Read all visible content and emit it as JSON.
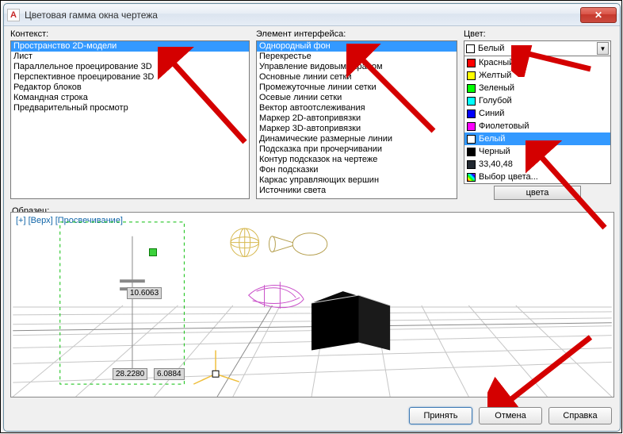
{
  "window": {
    "title": "Цветовая гамма окна чертежа",
    "icon_letter": "A"
  },
  "context": {
    "label": "Контекст:",
    "items": [
      "Пространство 2D-модели",
      "Лист",
      "Параллельное проецирование 3D",
      "Перспективное проецирование 3D",
      "Редактор блоков",
      "Командная строка",
      "Предварительный просмотр"
    ],
    "selected_index": 0
  },
  "elements": {
    "label": "Элемент интерфейса:",
    "items": [
      "Однородный фон",
      "Перекрестье",
      "Управление видовым экраном",
      "Основные линии сетки",
      "Промежуточные линии сетки",
      "Осевые линии сетки",
      "Вектор автоотслеживания",
      "Маркер 2D-автопривязки",
      "Маркер 3D-автопривязки",
      "Динамические размерные линии",
      "Подсказка при прочерчивании",
      "Контур подсказок на чертеже",
      "Фон подсказки",
      "Каркас управляющих вершин",
      "Источники света"
    ],
    "selected_index": 0
  },
  "color": {
    "label": "Цвет:",
    "selected_label": "Белый",
    "selected_swatch": "#ffffff",
    "options": [
      {
        "name": "Красный",
        "hex": "#ff0000"
      },
      {
        "name": "Желтый",
        "hex": "#ffff00"
      },
      {
        "name": "Зеленый",
        "hex": "#00ff00"
      },
      {
        "name": "Голубой",
        "hex": "#00ffff"
      },
      {
        "name": "Синий",
        "hex": "#0000ff"
      },
      {
        "name": "Фиолетовый",
        "hex": "#ff00ff"
      },
      {
        "name": "Белый",
        "hex": "#ffffff"
      },
      {
        "name": "Черный",
        "hex": "#000000"
      },
      {
        "name": "33,40,48",
        "hex": "#212830"
      },
      {
        "name": "Выбор цвета...",
        "hex": null
      }
    ],
    "selected_option_index": 6,
    "extra_button": "цвета"
  },
  "sample": {
    "label": "Образец:",
    "status": "[+] [Верх] [Просвечивание]",
    "coords": {
      "a": "10.6063",
      "b": "28.2280",
      "c": "6.0884"
    }
  },
  "buttons": {
    "accept": "Принять",
    "cancel": "Отмена",
    "help": "Справка"
  }
}
